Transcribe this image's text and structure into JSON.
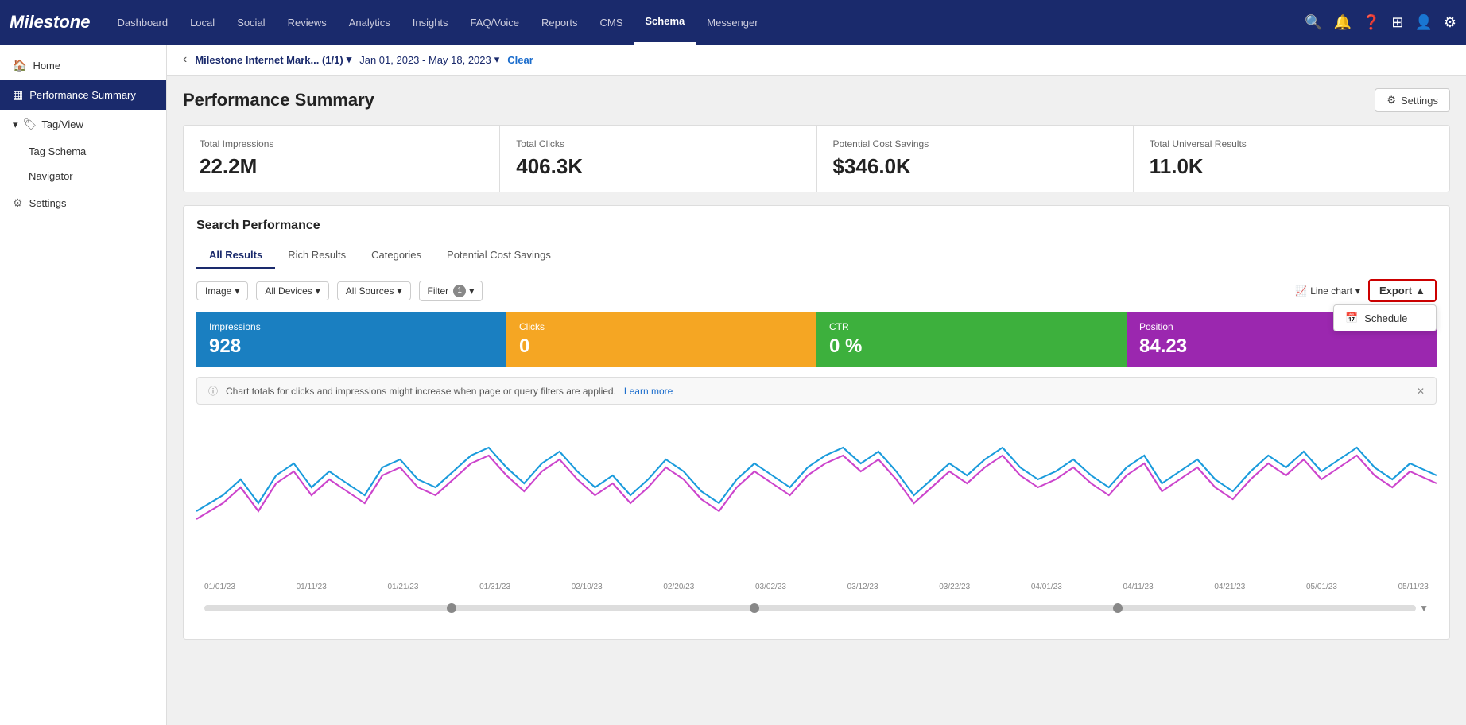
{
  "app": {
    "name": "Milestone"
  },
  "nav": {
    "links": [
      {
        "id": "dashboard",
        "label": "Dashboard"
      },
      {
        "id": "local",
        "label": "Local"
      },
      {
        "id": "social",
        "label": "Social"
      },
      {
        "id": "reviews",
        "label": "Reviews"
      },
      {
        "id": "analytics",
        "label": "Analytics"
      },
      {
        "id": "insights",
        "label": "Insights"
      },
      {
        "id": "faq-voice",
        "label": "FAQ/Voice"
      },
      {
        "id": "reports",
        "label": "Reports"
      },
      {
        "id": "cms",
        "label": "CMS"
      },
      {
        "id": "schema",
        "label": "Schema",
        "active": true
      },
      {
        "id": "messenger",
        "label": "Messenger"
      }
    ]
  },
  "breadcrumb": {
    "back_label": "‹",
    "company": "Milestone Internet Mark... (1/1)",
    "date_range": "Jan 01, 2023 - May 18, 2023",
    "clear_label": "Clear"
  },
  "sidebar": {
    "home_label": "Home",
    "items": [
      {
        "id": "performance-summary",
        "label": "Performance Summary",
        "icon": "▦",
        "active": true
      },
      {
        "id": "tag-view",
        "label": "Tag/View",
        "icon": "🏷"
      },
      {
        "id": "tag-schema",
        "label": "Tag Schema"
      },
      {
        "id": "navigator",
        "label": "Navigator"
      },
      {
        "id": "settings",
        "label": "Settings",
        "icon": "⚙"
      }
    ]
  },
  "page": {
    "title": "Performance Summary",
    "settings_label": "Settings"
  },
  "metrics": [
    {
      "id": "total-impressions",
      "label": "Total Impressions",
      "value": "22.2M"
    },
    {
      "id": "total-clicks",
      "label": "Total Clicks",
      "value": "406.3K"
    },
    {
      "id": "potential-cost-savings",
      "label": "Potential Cost Savings",
      "value": "$346.0K"
    },
    {
      "id": "total-universal-results",
      "label": "Total Universal Results",
      "value": "11.0K"
    }
  ],
  "search_performance": {
    "title": "Search Performance",
    "tabs": [
      {
        "id": "all-results",
        "label": "All Results",
        "active": true
      },
      {
        "id": "rich-results",
        "label": "Rich Results"
      },
      {
        "id": "categories",
        "label": "Categories"
      },
      {
        "id": "potential-cost-savings",
        "label": "Potential Cost Savings"
      }
    ],
    "filters": {
      "image_label": "Image",
      "all_devices_label": "All Devices",
      "all_sources_label": "All Sources",
      "filter_label": "Filter",
      "filter_count": "1"
    },
    "chart_controls": {
      "line_chart_label": "Line chart",
      "export_label": "Export",
      "export_icon": "▲"
    },
    "export_dropdown": [
      {
        "id": "schedule",
        "label": "Schedule",
        "icon": "📅"
      }
    ],
    "metric_bars": [
      {
        "id": "impressions",
        "label": "Impressions",
        "value": "928",
        "color_class": "impressions"
      },
      {
        "id": "clicks",
        "label": "Clicks",
        "value": "0",
        "color_class": "clicks"
      },
      {
        "id": "ctr",
        "label": "CTR",
        "value": "0 %",
        "color_class": "ctr"
      },
      {
        "id": "position",
        "label": "Position",
        "value": "84.23",
        "color_class": "position"
      }
    ],
    "info_message": "Chart totals for clicks and impressions might increase when page or query filters are applied.",
    "learn_more_label": "Learn more",
    "x_axis_labels": [
      "01/01/23",
      "01/11/23",
      "01/21/23",
      "01/31/23",
      "02/10/23",
      "02/20/23",
      "03/02/23",
      "03/12/23",
      "03/22/23",
      "04/01/23",
      "04/11/23",
      "04/21/23",
      "05/01/23",
      "05/11/23"
    ]
  }
}
